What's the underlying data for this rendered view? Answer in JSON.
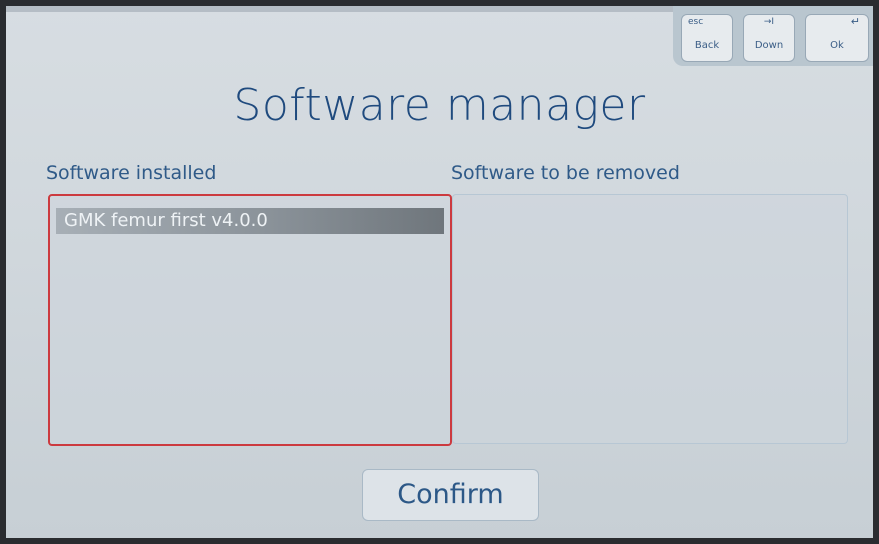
{
  "app": {
    "title": "Software manager"
  },
  "keys": {
    "back": {
      "hint": "esc",
      "label": "Back"
    },
    "down": {
      "hint": "→I",
      "label": "Down"
    },
    "ok": {
      "hint": "↵",
      "label": "Ok"
    }
  },
  "lists": {
    "installed": {
      "label": "Software installed",
      "items": [
        "GMK femur first v4.0.0"
      ]
    },
    "to_remove": {
      "label": "Software to be removed",
      "items": []
    }
  },
  "actions": {
    "confirm_label": "Confirm"
  },
  "colors": {
    "accent": "#1f4a7e",
    "selection_border": "#cc3a3f",
    "background": "#d1d8dd"
  },
  "icons": {
    "back": "esc-key-icon",
    "down": "tab-arrow-icon",
    "ok": "enter-key-icon"
  }
}
